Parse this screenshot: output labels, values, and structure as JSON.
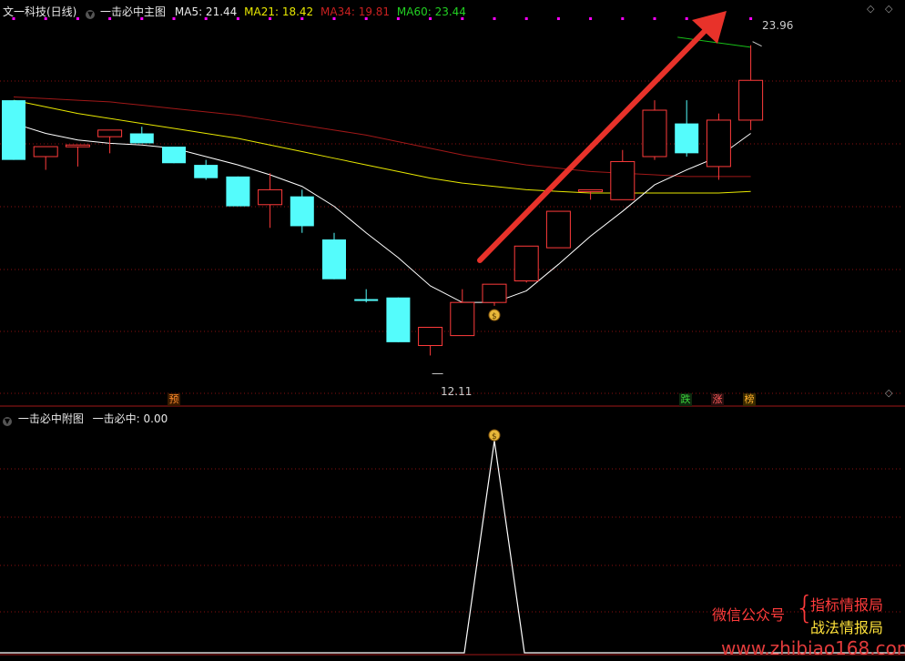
{
  "top": {
    "title": "文一科技(日线)",
    "indicator": "一击必中主图",
    "ma5": "MA5: 21.44",
    "ma21": "MA21: 18.42",
    "ma34": "MA34: 19.81",
    "ma60": "MA60: 23.44"
  },
  "sub": {
    "title": "一击必中附图",
    "value": "一击必中: 0.00"
  },
  "annotations": {
    "high_price": "23.96",
    "low_price": "12.11",
    "signal_pre": "预",
    "signal_drop": "跌",
    "signal_rise": "涨",
    "signal_rank": "榜"
  },
  "watermark": {
    "wechat": "微信公众号",
    "brace": "{",
    "line1": "指标情报局",
    "line2": "战法情报局",
    "site": "www.zhibiao168.com"
  },
  "colors": {
    "up": "#ff3b3b",
    "down": "#54fcfc",
    "ma5": "#ffffff",
    "ma21": "#e8e800",
    "ma34": "#a01818",
    "ma60": "#18c018",
    "grid": "#8a1010",
    "arrow": "#e8322a",
    "marker": "#ff00ff"
  },
  "chart_data": {
    "type": "candlestick",
    "candles": [
      {
        "o": 22.3,
        "h": 22.3,
        "l": 20.5,
        "c": 20.5
      },
      {
        "o": 20.6,
        "h": 20.9,
        "l": 20.2,
        "c": 20.9
      },
      {
        "o": 20.95,
        "h": 20.95,
        "l": 20.3,
        "c": 20.95
      },
      {
        "o": 21.2,
        "h": 21.3,
        "l": 20.7,
        "c": 21.4
      },
      {
        "o": 21.3,
        "h": 21.5,
        "l": 21.0,
        "c": 21.0
      },
      {
        "o": 20.9,
        "h": 20.9,
        "l": 20.4,
        "c": 20.4
      },
      {
        "o": 20.35,
        "h": 20.5,
        "l": 19.9,
        "c": 19.95
      },
      {
        "o": 20.0,
        "h": 20.0,
        "l": 19.1,
        "c": 19.1
      },
      {
        "o": 19.15,
        "h": 20.1,
        "l": 18.45,
        "c": 19.6
      },
      {
        "o": 19.4,
        "h": 19.6,
        "l": 18.3,
        "c": 18.5
      },
      {
        "o": 18.1,
        "h": 18.3,
        "l": 16.9,
        "c": 16.9
      },
      {
        "o": 16.3,
        "h": 16.6,
        "l": 16.2,
        "c": 16.25
      },
      {
        "o": 16.35,
        "h": 16.35,
        "l": 15.0,
        "c": 15.0
      },
      {
        "o": 14.9,
        "h": 15.1,
        "l": 14.6,
        "c": 15.45
      },
      {
        "o": 15.2,
        "h": 16.6,
        "l": 15.2,
        "c": 16.2
      },
      {
        "o": 16.2,
        "h": 16.5,
        "l": 16.1,
        "c": 16.75
      },
      {
        "o": 16.85,
        "h": 17.8,
        "l": 16.8,
        "c": 17.9
      },
      {
        "o": 17.85,
        "h": 18.95,
        "l": 17.85,
        "c": 18.95
      },
      {
        "o": 19.6,
        "h": 19.6,
        "l": 19.3,
        "c": 19.6
      },
      {
        "o": 19.3,
        "h": 20.8,
        "l": 19.3,
        "c": 20.45
      },
      {
        "o": 20.6,
        "h": 22.3,
        "l": 20.5,
        "c": 22.0
      },
      {
        "o": 21.6,
        "h": 22.3,
        "l": 20.6,
        "c": 20.7
      },
      {
        "o": 20.3,
        "h": 21.9,
        "l": 19.9,
        "c": 21.7
      },
      {
        "o": 21.7,
        "h": 23.96,
        "l": 21.4,
        "c": 22.9
      }
    ],
    "ma5": [
      21.6,
      21.3,
      21.1,
      21.0,
      20.95,
      20.85,
      20.6,
      20.35,
      20.05,
      19.7,
      19.1,
      18.3,
      17.55,
      16.7,
      16.2,
      16.2,
      16.55,
      17.35,
      18.2,
      18.95,
      19.75,
      20.2,
      20.6,
      21.3
    ],
    "ma21": [
      22.3,
      22.1,
      21.9,
      21.75,
      21.6,
      21.45,
      21.3,
      21.15,
      20.95,
      20.75,
      20.55,
      20.35,
      20.15,
      19.95,
      19.8,
      19.7,
      19.6,
      19.55,
      19.5,
      19.5,
      19.5,
      19.5,
      19.5,
      19.55
    ],
    "ma34": [
      22.4,
      22.35,
      22.3,
      22.25,
      22.15,
      22.05,
      21.95,
      21.85,
      21.7,
      21.55,
      21.4,
      21.25,
      21.05,
      20.85,
      20.65,
      20.5,
      20.35,
      20.25,
      20.15,
      20.1,
      20.05,
      20.0,
      20.0,
      20.0
    ],
    "subchart": {
      "name": "一击必中",
      "signal_index": 15,
      "peak": 1.0
    }
  }
}
